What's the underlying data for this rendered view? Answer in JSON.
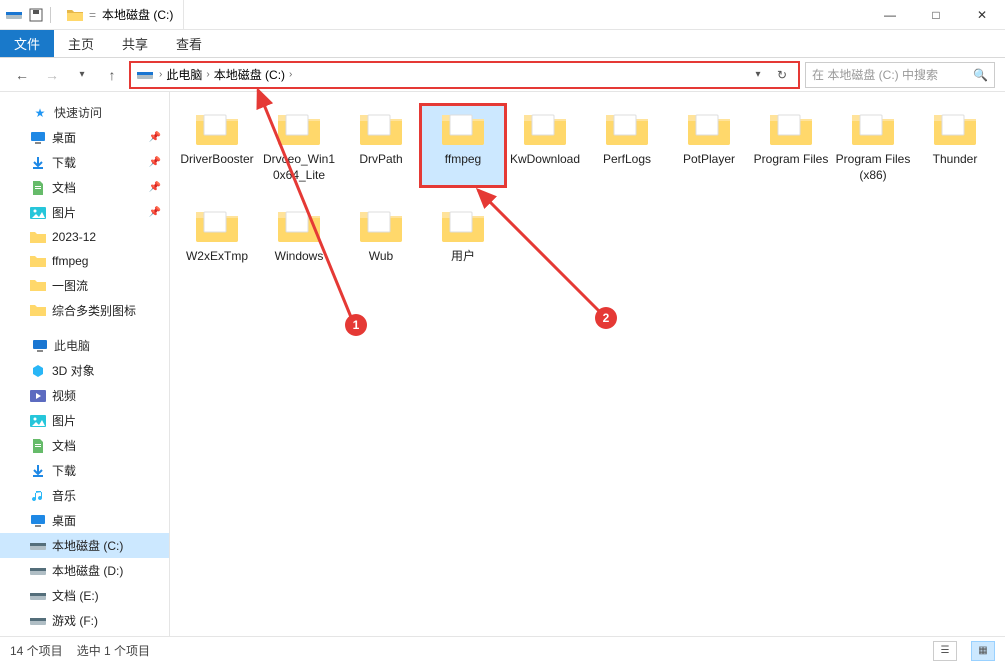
{
  "window": {
    "title": "本地磁盘 (C:)",
    "controls": {
      "min": "—",
      "max": "□",
      "close": "✕"
    }
  },
  "ribbon": {
    "file": "文件",
    "tabs": [
      "主页",
      "共享",
      "查看"
    ]
  },
  "nav": {
    "breadcrumb": [
      "此电脑",
      "本地磁盘 (C:)"
    ],
    "search_placeholder": "在 本地磁盘 (C:) 中搜索"
  },
  "sidebar": {
    "quick": {
      "label": "快速访问",
      "items": [
        {
          "label": "桌面",
          "pinned": true,
          "icon": "desktop"
        },
        {
          "label": "下载",
          "pinned": true,
          "icon": "download"
        },
        {
          "label": "文档",
          "pinned": true,
          "icon": "document"
        },
        {
          "label": "图片",
          "pinned": true,
          "icon": "picture"
        },
        {
          "label": "2023-12",
          "pinned": false,
          "icon": "folder"
        },
        {
          "label": "ffmpeg",
          "pinned": false,
          "icon": "folder"
        },
        {
          "label": "一图流",
          "pinned": false,
          "icon": "folder"
        },
        {
          "label": "综合多类别图标",
          "pinned": false,
          "icon": "folder"
        }
      ]
    },
    "thispc": {
      "label": "此电脑",
      "items": [
        {
          "label": "3D 对象",
          "icon": "3d"
        },
        {
          "label": "视频",
          "icon": "video"
        },
        {
          "label": "图片",
          "icon": "picture"
        },
        {
          "label": "文档",
          "icon": "document"
        },
        {
          "label": "下载",
          "icon": "download"
        },
        {
          "label": "音乐",
          "icon": "music"
        },
        {
          "label": "桌面",
          "icon": "desktop"
        },
        {
          "label": "本地磁盘 (C:)",
          "icon": "drive",
          "active": true
        },
        {
          "label": "本地磁盘 (D:)",
          "icon": "drive"
        },
        {
          "label": "文档 (E:)",
          "icon": "drive"
        },
        {
          "label": "游戏 (F:)",
          "icon": "drive"
        }
      ]
    }
  },
  "content": {
    "items": [
      {
        "label": "DriverBooster",
        "selected": false
      },
      {
        "label": "Drvceo_Win10x64_Lite",
        "selected": false
      },
      {
        "label": "DrvPath",
        "selected": false
      },
      {
        "label": "ffmpeg",
        "selected": true,
        "boxed": true
      },
      {
        "label": "KwDownload",
        "selected": false
      },
      {
        "label": "PerfLogs",
        "selected": false
      },
      {
        "label": "PotPlayer",
        "selected": false
      },
      {
        "label": "Program Files",
        "selected": false
      },
      {
        "label": "Program Files (x86)",
        "selected": false
      },
      {
        "label": "Thunder",
        "selected": false
      },
      {
        "label": "W2xExTmp",
        "selected": false
      },
      {
        "label": "Windows",
        "selected": false
      },
      {
        "label": "Wub",
        "selected": false
      },
      {
        "label": "用户",
        "selected": false
      }
    ]
  },
  "status": {
    "count": "14 个项目",
    "selection": "选中 1 个项目"
  },
  "annotations": {
    "marker1": "1",
    "marker2": "2"
  },
  "colors": {
    "accent": "#1979ca",
    "highlight": "#e53935",
    "select": "#cce8ff"
  }
}
